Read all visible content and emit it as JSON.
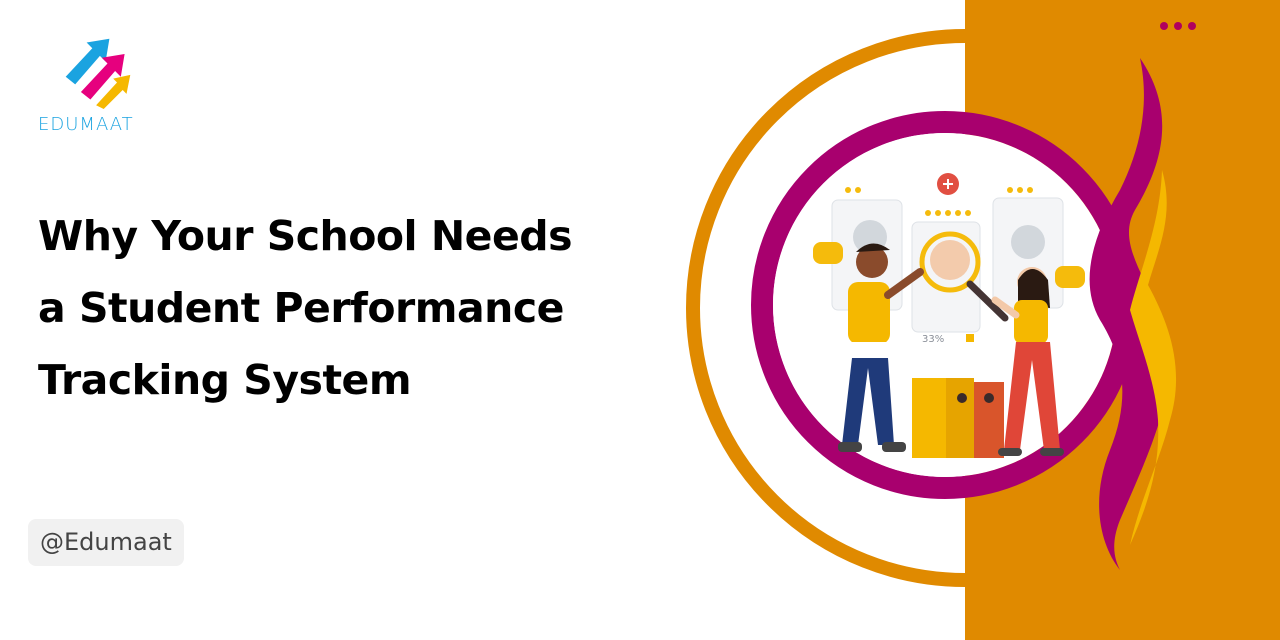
{
  "brand": {
    "name": "EDUMAAT",
    "handle": "@Edumaat"
  },
  "headline": {
    "lines": [
      "Why Your School Needs",
      "a Student Performance",
      "Tracking System"
    ]
  },
  "illustration": {
    "percent_label": "33%"
  },
  "colors": {
    "orange": "#e08a00",
    "magenta": "#a8006e",
    "ring_orange": "#e08a00",
    "yellow": "#f5b800",
    "logo_blue": "#1aa3e0",
    "logo_pink": "#e6007e",
    "text": "#000000"
  },
  "icons": {
    "more": "more-dots-icon",
    "logo": "edumaat-arrow-logo-icon"
  }
}
